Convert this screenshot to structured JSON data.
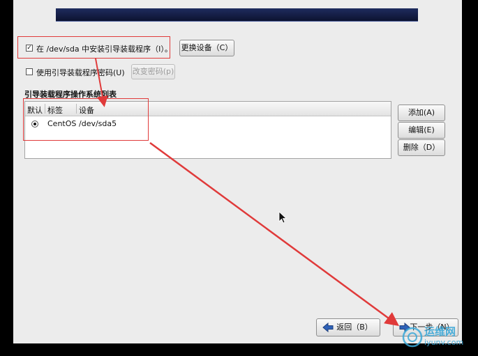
{
  "options": {
    "install_bootloader_label": "在 /dev/sda 中安装引导装载程序（I）。",
    "install_bootloader_checked": true,
    "change_device_button": "更换设备（C）",
    "use_password_label": "使用引导装载程序密码(U)",
    "use_password_checked": false,
    "change_password_button": "改变密码(p)"
  },
  "os_list": {
    "title": "引导装载程序操作系统列表",
    "columns": [
      "默认",
      "标签",
      "设备"
    ],
    "rows": [
      {
        "default": true,
        "label": "CentOS",
        "device": "/dev/sda5"
      }
    ]
  },
  "side_buttons": {
    "add": "添加(A)",
    "edit": "编辑(E)",
    "delete": "删除（D）"
  },
  "nav": {
    "back": "返回（B）",
    "next": "下一步（N）"
  },
  "watermark": {
    "brand": "运维网",
    "site": "iyunv.com"
  },
  "colors": {
    "annotation_red": "#e03a3a",
    "banner": "#151e45"
  }
}
